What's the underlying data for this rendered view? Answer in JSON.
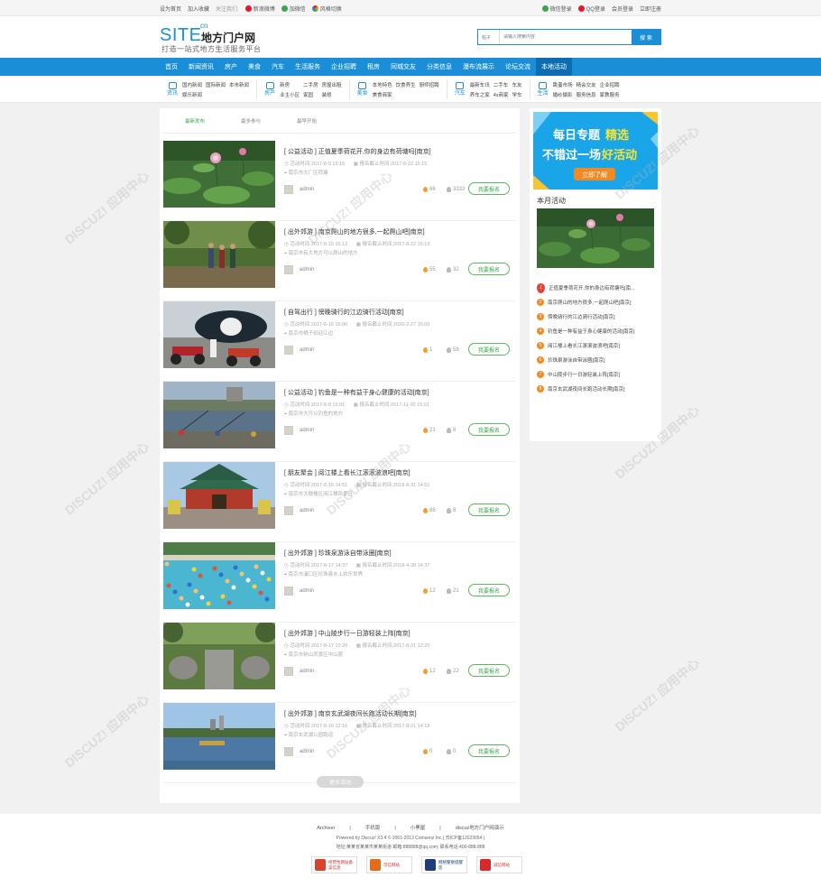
{
  "topbar": {
    "left": [
      "设为首页",
      "加入收藏",
      "关注我们:",
      "新浪微博",
      "加微信",
      "风格切换"
    ],
    "right": [
      "微信登录",
      "QQ登录",
      "会员登录",
      "立即注册"
    ]
  },
  "logo": {
    "site": "SITE",
    "cn": "cn",
    "name": "地方门户网",
    "slogan": "打造一站式地方生活服务平台"
  },
  "search": {
    "category": "帖子",
    "placeholder": "请输入搜索内容",
    "button": "搜 索"
  },
  "nav": [
    "首页",
    "新闻资讯",
    "房产",
    "美食",
    "汽车",
    "生活服务",
    "企业招聘",
    "租房",
    "同城交友",
    "分类信息",
    "瀑布流展示",
    "论坛交流",
    "本地活动"
  ],
  "subnav": [
    {
      "head": "资讯",
      "links": [
        "国内新闻",
        "国际新闻",
        "本市新闻",
        "娱乐新闻"
      ]
    },
    {
      "head": "房产",
      "links": [
        "新房",
        "二手房",
        "房屋出租",
        "业主小区",
        "家园",
        "装修"
      ]
    },
    {
      "head": "美食",
      "links": [
        "本地特色",
        "饮食养生",
        "厨师招聘",
        "美食商家"
      ]
    },
    {
      "head": "汽车",
      "links": [
        "最新车讯",
        "二手车",
        "车友",
        "养车之家",
        "4s商家",
        "学车"
      ]
    },
    {
      "head": "生活",
      "links": [
        "跳蚤市场",
        "精会交友",
        "企业招聘",
        "婚纱摄影",
        "服务信息",
        "家教服务"
      ]
    }
  ],
  "tabs": [
    "最新发布",
    "最多参与",
    "最早开始"
  ],
  "activities": [
    {
      "title": "[ 公益活动 ] 正值夏季荷花开,你的身边有荷塘吗[南京]",
      "start": "活动时间:2017-8-9 15:15",
      "deadline": "报名截止时间:2017-8-22 15:15",
      "location": "南京市大厂区荷塘",
      "author": "admin",
      "views": "66",
      "joined": "3333",
      "btn": "我要报名",
      "scene": "lotus"
    },
    {
      "title": "[ 出外郊游 ] 南京爬山的地方很多,一起爬山吧[南京]",
      "start": "活动时间:2017-8-15 15:13",
      "deadline": "报名截止时间:2017-8-22 15:13",
      "location": "南京市有大地方可以爬山的地方",
      "author": "admin",
      "views": "55",
      "joined": "32",
      "btn": "我要报名",
      "scene": "hike"
    },
    {
      "title": "[ 自驾出行 ] 傍晚骑行的江边骑行活动[南京]",
      "start": "活动时间:2017-8-16 15:06",
      "deadline": "报名截止时间:2020-2-27 15:06",
      "location": "南京市栖子矶迎江边",
      "author": "admin",
      "views": "1",
      "joined": "58",
      "btn": "我要报名",
      "scene": "moto"
    },
    {
      "title": "[ 公益活动 ] 钓鱼是一种有益于身心健康的活动[南京]",
      "start": "活动时间:2017-8-8 15:01",
      "deadline": "报名截止时间:2017-11-30 15:01",
      "location": "南京市大可以钓鱼的地方",
      "author": "admin",
      "views": "21",
      "joined": "8",
      "btn": "我要报名",
      "scene": "fish"
    },
    {
      "title": "[ 朋友聚会 ] 阅江楼上看长江滚滚波浪吧[南京]",
      "start": "活动时间:2017-8-15 14:51",
      "deadline": "报名截止时间:2018-8-31 14:51",
      "location": "南京市大鼓楼区阅江楼风景区",
      "author": "admin",
      "views": "88",
      "joined": "8",
      "btn": "我要报名",
      "scene": "temple"
    },
    {
      "title": "[ 出外郊游 ] 珍珠泉游泳自带泳圈[南京]",
      "start": "活动时间:2017-8-17 14:37",
      "deadline": "报名截止时间:2018-4-28 14:37",
      "location": "南京市浦口区珍珠泉水上欢乐世界",
      "author": "admin",
      "views": "12",
      "joined": "21",
      "btn": "我要报名",
      "scene": "pool"
    },
    {
      "title": "[ 出外郊游 ] 中山陵步行一日游轻装上阵[南京]",
      "start": "活动时间:2017-8-17 12:20",
      "deadline": "报名截止时间:2017-8-21 12:20",
      "location": "南京市钟山风景区中山陵",
      "author": "admin",
      "views": "12",
      "joined": "22",
      "btn": "我要报名",
      "scene": "statue"
    },
    {
      "title": "[ 出外郊游 ] 南京玄武湖夜间长跑活动长期[南京]",
      "start": "活动时间:2017-8-19 12:16",
      "deadline": "报名截止时间:2017-8-21 14:18",
      "location": "南京玄武湖公园跑道",
      "author": "admin",
      "views": "0",
      "joined": "0",
      "btn": "我要报名",
      "scene": "lake"
    }
  ],
  "more": "更多活动",
  "sidebar": {
    "banner": {
      "line1": "每日专题",
      "line1b": "精选",
      "line2": "不错过一场",
      "line2b": "好活动",
      "btn": "立即了解"
    },
    "heading": "本月活动",
    "ranking": [
      "正值夏季荷花开,你的身边有荷塘吗[南...",
      "南京爬山的地方很多,一起爬山吧[南京]",
      "傍晚骑行的江边骑行活动[南京]",
      "钓鱼是一种有益于身心健康的活动[南京]",
      "阅江楼上看长江滚滚波浪吧[南京]",
      "珍珠泉游泳自带泳圈[南京]",
      "中山陵步行一日游轻装上阵[南京]",
      "南京玄武湖夜间长跑活动长期[南京]"
    ]
  },
  "footer": {
    "links": [
      "Archiver",
      "|",
      "手机版",
      "|",
      "小黑屋",
      "|",
      "discuz地方门户网演示"
    ],
    "powered": "Powered by Discuz! X3.4 © 2001-2013 Comsenz Inc.( 苏ICP备12023054 )",
    "address": "地址:某某省某某市某某街道 邮箱:888888@qq.com; 联系电话:400-888-888",
    "badges": [
      "经营性网站备案信息",
      "可信网站",
      "网络警察提醒您",
      "诚信网站"
    ]
  },
  "colors": {
    "primary": "#1a8fd8",
    "nav_active": "#0d6db3",
    "green": "#3aa64d",
    "orange": "#f08a24"
  }
}
